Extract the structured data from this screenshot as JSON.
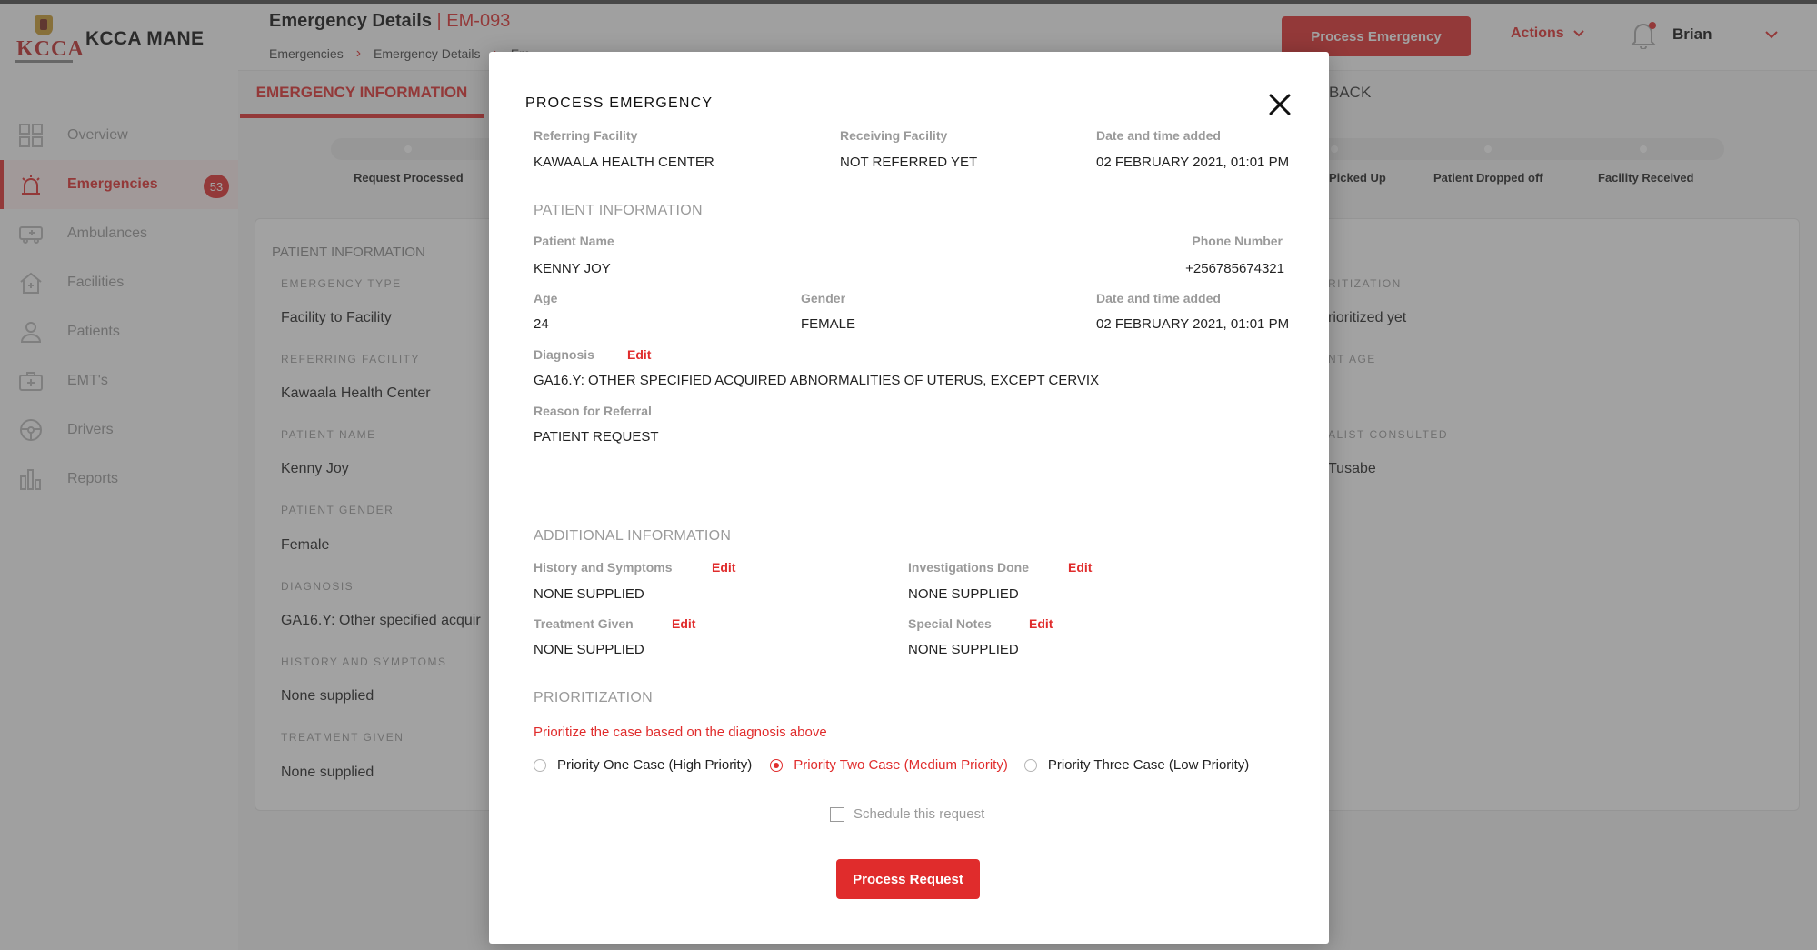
{
  "brand": {
    "logo_text": "KCCA",
    "name": "KCCA MANE"
  },
  "sidebar": {
    "items": [
      {
        "label": "Overview",
        "icon": "grid-icon"
      },
      {
        "label": "Emergencies",
        "icon": "siren-icon",
        "badge": "53"
      },
      {
        "label": "Ambulances",
        "icon": "ambulance-icon"
      },
      {
        "label": "Facilities",
        "icon": "hospital-icon"
      },
      {
        "label": "Patients",
        "icon": "patient-icon"
      },
      {
        "label": "EMT's",
        "icon": "medkit-icon"
      },
      {
        "label": "Drivers",
        "icon": "steering-wheel-icon"
      },
      {
        "label": "Reports",
        "icon": "bar-chart-icon"
      }
    ]
  },
  "header": {
    "title": "Emergency Details",
    "code": "| EM-093",
    "breadcrumb": [
      "Emergencies",
      "Emergency Details",
      "Em..."
    ],
    "process_button": "Process Emergency",
    "actions_label": "Actions",
    "user_name": "Brian"
  },
  "tabs": {
    "info": "EMERGENCY INFORMATION",
    "back": "BACK"
  },
  "progress_steps": [
    "Request Processed",
    "Picked Up",
    "Patient Dropped off",
    "Facility Received"
  ],
  "background_card": {
    "section": "PATIENT INFORMATION",
    "left": [
      {
        "label": "EMERGENCY TYPE",
        "value": "Facility to Facility"
      },
      {
        "label": "REFERRING FACILITY",
        "value": "Kawaala Health Center"
      },
      {
        "label": "PATIENT NAME",
        "value": "Kenny Joy"
      },
      {
        "label": "PATIENT GENDER",
        "value": "Female"
      },
      {
        "label": "DIAGNOSIS",
        "value": "GA16.Y: Other specified acquir"
      },
      {
        "label": "HISTORY AND SYMPTOMS",
        "value": "None supplied"
      },
      {
        "label": "TREATMENT GIVEN",
        "value": "None supplied"
      }
    ],
    "right": [
      {
        "label": "RITIZATION",
        "value": "rioritized yet"
      },
      {
        "label": "NT AGE",
        "value": ""
      },
      {
        "label": "ALIST CONSULTED",
        "value": "Tusabe"
      }
    ]
  },
  "modal": {
    "title": "PROCESS EMERGENCY",
    "referring_facility": {
      "label": "Referring Facility",
      "value": "KAWAALA HEALTH CENTER"
    },
    "receiving_facility": {
      "label": "Receiving Facility",
      "value": "NOT REFERRED YET"
    },
    "date_added_top": {
      "label": "Date and time added",
      "value": "02 FEBRUARY 2021, 01:01 PM"
    },
    "patient_section": "PATIENT INFORMATION",
    "patient_name": {
      "label": "Patient Name",
      "value": "KENNY JOY"
    },
    "phone": {
      "label": "Phone Number",
      "value": "+256785674321"
    },
    "age": {
      "label": "Age",
      "value": "24"
    },
    "gender": {
      "label": "Gender",
      "value": "FEMALE"
    },
    "date_added": {
      "label": "Date and time added",
      "value": "02 FEBRUARY 2021, 01:01 PM"
    },
    "diagnosis": {
      "label": "Diagnosis",
      "value": "GA16.Y: OTHER SPECIFIED ACQUIRED ABNORMALITIES OF UTERUS, EXCEPT CERVIX"
    },
    "reason": {
      "label": "Reason for Referral",
      "value": "PATIENT REQUEST"
    },
    "additional_section": "ADDITIONAL INFORMATION",
    "history": {
      "label": "History and Symptoms",
      "value": "NONE SUPPLIED"
    },
    "investigations": {
      "label": "Investigations Done",
      "value": "NONE SUPPLIED"
    },
    "treatment": {
      "label": "Treatment Given",
      "value": "NONE SUPPLIED"
    },
    "notes": {
      "label": "Special Notes",
      "value": "NONE SUPPLIED"
    },
    "edit_label": "Edit",
    "prioritization_section": "PRIORITIZATION",
    "prompt": "Prioritize the case based on the diagnosis above",
    "priorities": [
      "Priority One Case (High Priority)",
      "Priority Two Case (Medium Priority)",
      "Priority Three Case (Low Priority)"
    ],
    "selected_priority": "Priority Two Case (Medium Priority)",
    "schedule_label": "Schedule this request",
    "schedule_checked": false,
    "submit": "Process Request"
  },
  "colors": {
    "accent": "#e02c2c",
    "muted": "#9a9a9a"
  }
}
